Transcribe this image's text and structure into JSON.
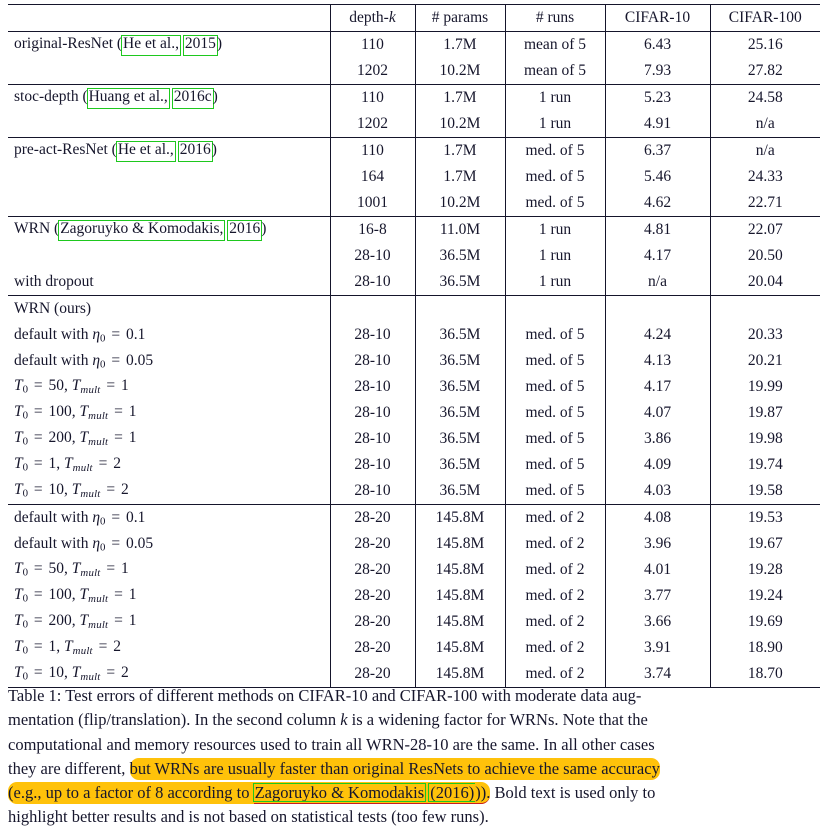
{
  "table": {
    "columns": [
      "",
      "depth-k",
      "# params",
      "# runs",
      "CIFAR-10",
      "CIFAR-100"
    ],
    "header": {
      "method": "",
      "depth": "depth-k",
      "params": "# params",
      "runs": "# runs",
      "cifar10": "CIFAR-10",
      "cifar100": "CIFAR-100"
    },
    "rows": [
      {
        "method": "original-ResNet (He et al., 2015)",
        "method_cite_author": "He et al.,",
        "method_cite_year": "2015",
        "depth": "110",
        "params": "1.7M",
        "runs": "mean of 5",
        "cifar10": "6.43",
        "cifar100": "25.16"
      },
      {
        "method": "",
        "depth": "1202",
        "params": "10.2M",
        "runs": "mean of 5",
        "cifar10": "7.93",
        "cifar100": "27.82"
      },
      {
        "method": "stoc-depth (Huang et al., 2016c)",
        "method_cite_author": "Huang et al.,",
        "method_cite_year": "2016c",
        "depth": "110",
        "params": "1.7M",
        "runs": "1 run",
        "cifar10": "5.23",
        "cifar100": "24.58"
      },
      {
        "method": "",
        "depth": "1202",
        "params": "10.2M",
        "runs": "1 run",
        "cifar10": "4.91",
        "cifar100": "n/a"
      },
      {
        "method": "pre-act-ResNet (He et al., 2016)",
        "method_cite_author": "He et al.,",
        "method_cite_year": "2016",
        "depth": "110",
        "params": "1.7M",
        "runs": "med. of 5",
        "cifar10": "6.37",
        "cifar100": "n/a"
      },
      {
        "method": "",
        "depth": "164",
        "params": "1.7M",
        "runs": "med. of 5",
        "cifar10": "5.46",
        "cifar100": "24.33"
      },
      {
        "method": "",
        "depth": "1001",
        "params": "10.2M",
        "runs": "med. of 5",
        "cifar10": "4.62",
        "cifar100": "22.71"
      },
      {
        "method": "WRN (Zagoruyko & Komodakis, 2016)",
        "method_cite_author": "Zagoruyko & Komodakis,",
        "method_cite_year": "2016",
        "depth": "16-8",
        "params": "11.0M",
        "runs": "1 run",
        "cifar10": "4.81",
        "cifar100": "22.07"
      },
      {
        "method": "",
        "depth": "28-10",
        "params": "36.5M",
        "runs": "1 run",
        "cifar10": "4.17",
        "cifar100": "20.50"
      },
      {
        "method": "with dropout",
        "depth": "28-10",
        "params": "36.5M",
        "runs": "1 run",
        "cifar10": "n/a",
        "cifar100": "20.04"
      },
      {
        "method": "WRN (ours)",
        "depth": "",
        "params": "",
        "runs": "",
        "cifar10": "",
        "cifar100": ""
      },
      {
        "method": "default with η₀ = 0.1",
        "depth": "28-10",
        "params": "36.5M",
        "runs": "med. of 5",
        "cifar10": "4.24",
        "cifar100": "20.33"
      },
      {
        "method": "default with η₀ = 0.05",
        "depth": "28-10",
        "params": "36.5M",
        "runs": "med. of 5",
        "cifar10": "4.13",
        "cifar100": "20.21"
      },
      {
        "method": "T₀ = 50, T_mult = 1",
        "depth": "28-10",
        "params": "36.5M",
        "runs": "med. of 5",
        "cifar10": "4.17",
        "cifar100": "19.99"
      },
      {
        "method": "T₀ = 100, T_mult = 1",
        "depth": "28-10",
        "params": "36.5M",
        "runs": "med. of 5",
        "cifar10": "4.07",
        "cifar100": "19.87"
      },
      {
        "method": "T₀ = 200, T_mult = 1",
        "depth": "28-10",
        "params": "36.5M",
        "runs": "med. of 5",
        "cifar10": "3.86",
        "cifar100": "19.98"
      },
      {
        "method": "T₀ = 1, T_mult = 2",
        "depth": "28-10",
        "params": "36.5M",
        "runs": "med. of 5",
        "cifar10": "4.09",
        "cifar100": "19.74"
      },
      {
        "method": "T₀ = 10, T_mult = 2",
        "depth": "28-10",
        "params": "36.5M",
        "runs": "med. of 5",
        "cifar10": "4.03",
        "cifar100": "19.58"
      },
      {
        "method": "default with η₀ = 0.1",
        "depth": "28-20",
        "params": "145.8M",
        "runs": "med. of 2",
        "cifar10": "4.08",
        "cifar100": "19.53"
      },
      {
        "method": "default with η₀ = 0.05",
        "depth": "28-20",
        "params": "145.8M",
        "runs": "med. of 2",
        "cifar10": "3.96",
        "cifar100": "19.67"
      },
      {
        "method": "T₀ = 50, T_mult = 1",
        "depth": "28-20",
        "params": "145.8M",
        "runs": "med. of 2",
        "cifar10": "4.01",
        "cifar100": "19.28"
      },
      {
        "method": "T₀ = 100, T_mult = 1",
        "depth": "28-20",
        "params": "145.8M",
        "runs": "med. of 2",
        "cifar10": "3.77",
        "cifar10_bold": true,
        "cifar100": "19.24"
      },
      {
        "method": "T₀ = 200, T_mult = 1",
        "depth": "28-20",
        "params": "145.8M",
        "runs": "med. of 2",
        "cifar10": "3.66",
        "cifar10_bold": true,
        "cifar100": "19.69"
      },
      {
        "method": "T₀ = 1, T_mult = 2",
        "depth": "28-20",
        "params": "145.8M",
        "runs": "med. of 2",
        "cifar10": "3.91",
        "cifar100": "18.90",
        "cifar100_bold": true
      },
      {
        "method": "T₀ = 10, T_mult = 2",
        "depth": "28-20",
        "params": "145.8M",
        "runs": "med. of 2",
        "cifar10": "3.74",
        "cifar10_bold": true,
        "cifar100": "18.70",
        "cifar100_bold": true
      }
    ],
    "cells": {
      "depth_110": "110",
      "depth_1202": "1202",
      "depth_164": "164",
      "depth_1001": "1001",
      "depth_16_8": "16-8",
      "depth_28_10": "28-10",
      "depth_28_20": "28-20",
      "p_17": "1.7M",
      "p_102": "10.2M",
      "p_110": "11.0M",
      "p_365": "36.5M",
      "p_1458": "145.8M",
      "r_mean5": "mean of 5",
      "r_1run": "1 run",
      "r_med5": "med. of 5",
      "r_med2": "med. of 2",
      "na": "n/a"
    },
    "labels": {
      "original_resnet_pre": "original-ResNet (",
      "original_resnet_post": ")",
      "stoc_depth_pre": "stoc-depth (",
      "stoc_depth_post": ")",
      "pre_act_pre": "pre-act-ResNet (",
      "pre_act_post": ")",
      "wrn_pre": "WRN (",
      "wrn_post": ")",
      "with_dropout": "with dropout",
      "wrn_ours": "WRN (ours)",
      "default_with": "default with",
      "eta": "η",
      "zero": "0",
      "eq": "=",
      "v_0_1": "0.1",
      "v_0_05": "0.05",
      "T": "T",
      "mult": "mult",
      "comma": ",",
      "v50": "50",
      "v100": "100",
      "v200": "200",
      "v1": "1",
      "v10": "10",
      "v2": "2",
      "cite_he_2015_author": "He et al.,",
      "cite_he_2015_year": "2015",
      "cite_huang_author": "Huang et al.,",
      "cite_huang_year": "2016c",
      "cite_he_2016_author": "He et al.,",
      "cite_he_2016_year": "2016",
      "cite_zk_author": "Zagoruyko & Komodakis,",
      "cite_zk_year": "2016"
    }
  },
  "caption": {
    "line1": "Table 1: Test errors of different methods on CIFAR-10 and CIFAR-100 with moderate data aug-",
    "line2_a": "mentation (flip/translation).  In the second column",
    "line2_k": "k",
    "line2_b": "is a widening factor for WRNs.  Note that the",
    "line3": "computational and memory resources used to train all WRN-28-10 are the same.  In all other cases",
    "line4_plain": "they are different,",
    "line4_hl": "but WRNs are usually faster than original ResNets to achieve the same accuracy",
    "line5_hl_a": "(e.g., up to a factor of 8 according to",
    "line5_cite_author": "Zagoruyko & Komodakis",
    "line5_cite_year": "(2016)",
    "line5_hl_b": ")).",
    "line5_plain": "Bold text is used only to",
    "line6": "highlight better results and is not based on statistical tests (too few runs)."
  },
  "colors": {
    "highlight": "#ffc20a",
    "cite_box": "#1ec81e",
    "link_underline": "#c81e1e",
    "text": "#16162c",
    "rule": "#15152b"
  }
}
